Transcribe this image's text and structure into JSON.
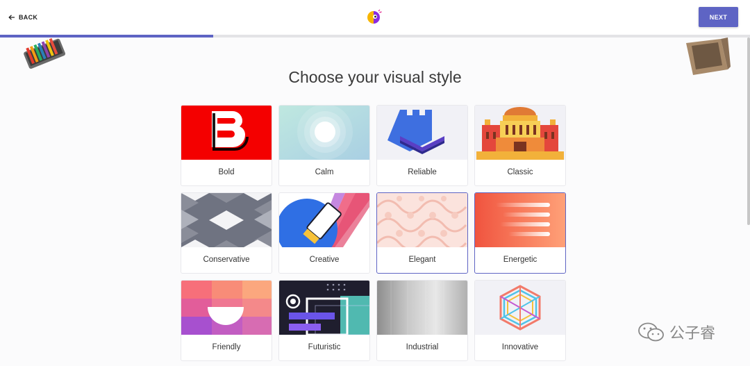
{
  "header": {
    "back_label": "BACK",
    "next_label": "NEXT",
    "progress_fraction": 0.284
  },
  "page_title": "Choose your visual style",
  "styles": [
    {
      "label": "Bold",
      "selected": false
    },
    {
      "label": "Calm",
      "selected": false
    },
    {
      "label": "Reliable",
      "selected": false
    },
    {
      "label": "Classic",
      "selected": false
    },
    {
      "label": "Conservative",
      "selected": false
    },
    {
      "label": "Creative",
      "selected": false
    },
    {
      "label": "Elegant",
      "selected": true
    },
    {
      "label": "Energetic",
      "selected": true
    },
    {
      "label": "Friendly",
      "selected": false
    },
    {
      "label": "Futuristic",
      "selected": false
    },
    {
      "label": "Industrial",
      "selected": false
    },
    {
      "label": "Innovative",
      "selected": false
    }
  ],
  "watermark": "公子睿",
  "colors": {
    "accent": "#5e64c4",
    "bold_red": "#f40000"
  }
}
